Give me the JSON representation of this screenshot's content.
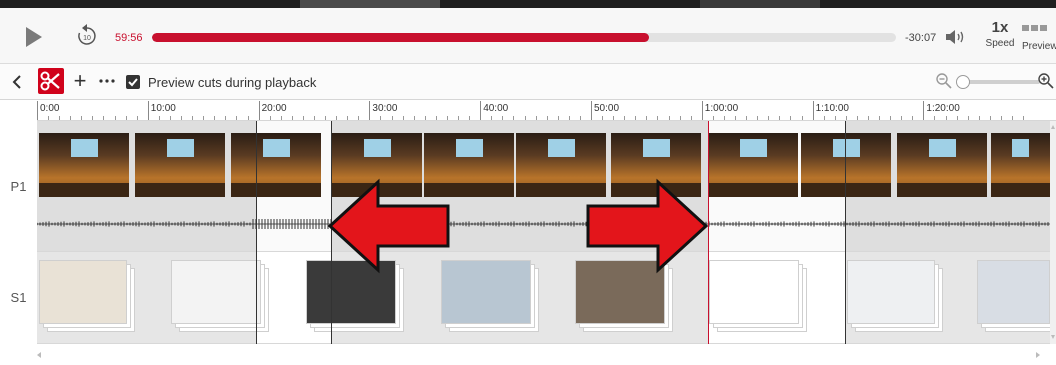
{
  "player": {
    "elapsed": "59:56",
    "remaining": "-30:07",
    "progress_fraction": 0.668,
    "speed_value": "1x",
    "speed_label": "Speed",
    "preview_label": "Preview"
  },
  "toolbar": {
    "preview_cuts_label": "Preview cuts during playback",
    "preview_cuts_checked": true,
    "zoom_level": 0
  },
  "ruler": {
    "labels": [
      "0:00",
      "10:00",
      "20:00",
      "30:00",
      "40:00",
      "50:00",
      "1:00:00",
      "1:10:00",
      "1:20:00"
    ]
  },
  "tracks": [
    {
      "label": "P1",
      "kind": "video"
    },
    {
      "label": "S1",
      "kind": "slides"
    }
  ],
  "colors": {
    "accent": "#c8102e",
    "arrow": "#e3151b",
    "cut_region": "#dcdcdc",
    "playhead": "#c8102e"
  },
  "icons": [
    "play-icon",
    "rewind-10-icon",
    "volume-icon",
    "preview-icon",
    "chevron-left-icon",
    "scissors-icon",
    "plus-icon",
    "more-icon",
    "check-icon",
    "zoom-out-icon",
    "zoom-in-icon",
    "arrow-left-icon",
    "arrow-right-icon"
  ]
}
